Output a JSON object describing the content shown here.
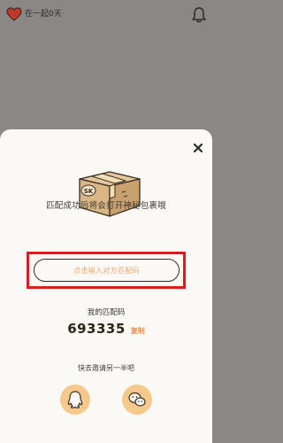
{
  "header": {
    "days_text": "在一起0天",
    "heart_icon": "heart-icon",
    "bell_icon": "bell-icon"
  },
  "dialog": {
    "close_icon": "close-icon",
    "illustration": "package-box-icon",
    "box_label": "SK",
    "message": "匹配成功后将会打开神秘包裹哦",
    "input_placeholder": "点击输入对方匹配码",
    "my_code_label": "我的匹配码",
    "my_code": "693335",
    "copy_label": "复制",
    "invite_label": "快去邀请另一半吧",
    "share": [
      {
        "icon": "qq-icon"
      },
      {
        "icon": "wechat-icon"
      }
    ]
  },
  "colors": {
    "overlay": "#8a8785",
    "sheet": "#fbf9f6",
    "accent": "#e9914d",
    "placeholder": "#e9a56c",
    "share_bg": "#f5c98b",
    "highlight": "#e8161c",
    "heart": "#c0392b"
  }
}
